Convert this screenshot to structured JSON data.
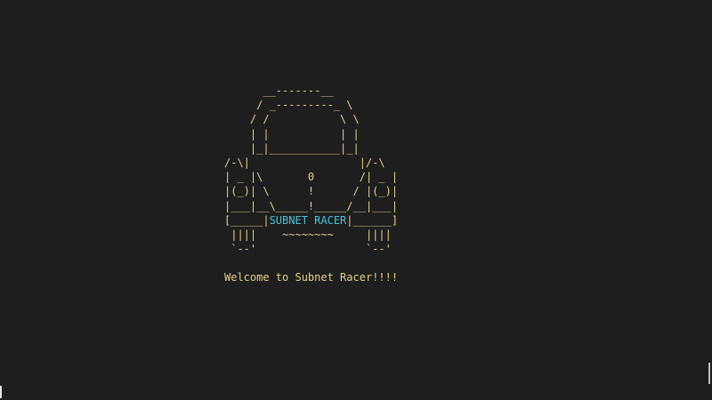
{
  "game": {
    "art_lines": [
      "      __-------__",
      "     / _---------_ \\",
      "    / /           \\ \\",
      "    | |           | |",
      "    |_|___________|_|",
      "/-\\|                 |/-\\",
      "| _ |\\       0       /| _ |",
      "|(_)| \\      !      / |(_)|",
      "|___|__\\_____!_____/__|___|"
    ],
    "badge_prefix": "[_____|",
    "badge_text": "SUBNET RACER",
    "badge_suffix": "|______]",
    "art_bottom": [
      " ||||    ~~~~~~~~     ||||",
      " `--'                 `--'"
    ],
    "welcome": "Welcome to Subnet Racer!!!!"
  },
  "colors": {
    "background": "#1e1e1e",
    "art": "#e5d08a",
    "badge": "#4fc3d9"
  }
}
